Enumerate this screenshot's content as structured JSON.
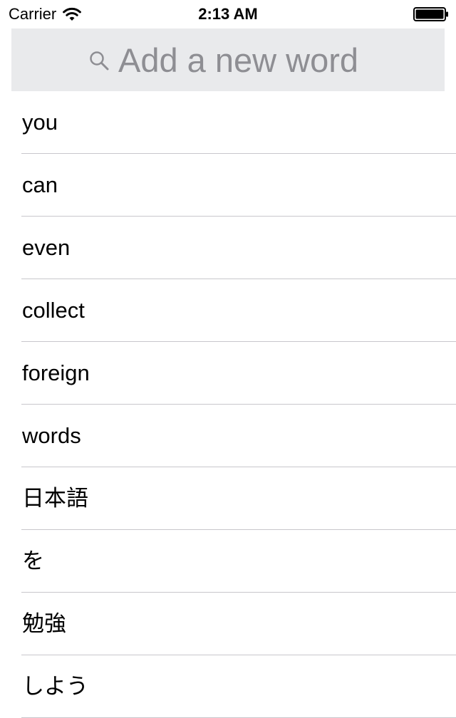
{
  "status_bar": {
    "carrier": "Carrier",
    "time": "2:13 AM",
    "battery_level": 1.0
  },
  "search": {
    "placeholder": "Add a new word",
    "value": "",
    "icon": "search-icon"
  },
  "words": [
    "you",
    "can",
    "even",
    "collect",
    "foreign",
    "words",
    "日本語",
    "を",
    "勉強",
    "しよう"
  ],
  "colors": {
    "search_background": "#e9eaec",
    "placeholder": "#8e8e93",
    "separator": "#c8c7cc"
  }
}
